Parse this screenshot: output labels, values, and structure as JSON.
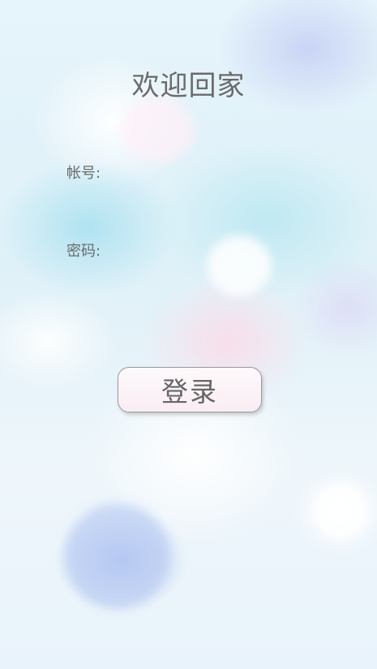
{
  "header": {
    "title": "欢迎回家"
  },
  "form": {
    "username_label": "帐号:",
    "username_value": "",
    "password_label": "密码:",
    "password_value": "",
    "login_label": "登录"
  },
  "colors": {
    "text": "#6b6b6b",
    "button_border": "#9a9a9a",
    "button_fill": "#fbf0f4",
    "background_sky": "#e6f4fb"
  }
}
